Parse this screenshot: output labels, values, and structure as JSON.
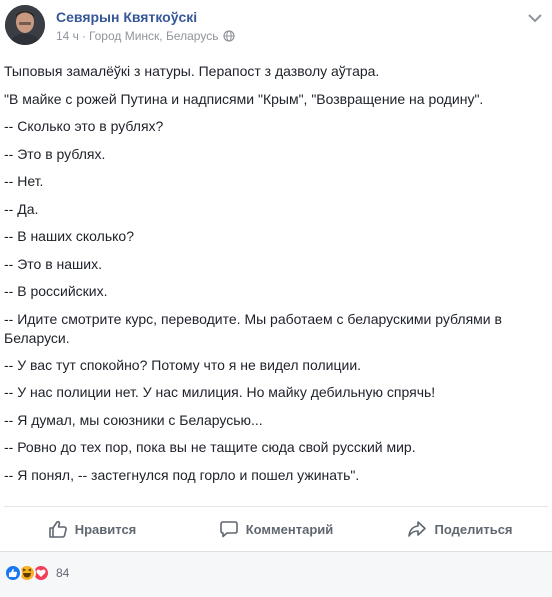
{
  "post": {
    "author": "Севярын Квяткоўскі",
    "time": "14 ч",
    "separator": "·",
    "location": "Город Минск, Беларусь",
    "privacy_icon": "globe-icon",
    "menu_icon": "chevron-down-icon",
    "paragraphs": [
      "Тыповыя замалёўкі з натуры. Перапост з дазволу аўтара.",
      "\"В майке с рожей Путина и надписями \"Крым\", \"Возвращение на родину\".",
      "-- Сколько это в рублях?",
      "-- Это в рублях.",
      "-- Нет.",
      "-- Да.",
      "-- В наших сколько?",
      "-- Это в наших.",
      "-- В российских.",
      "-- Идите смотрите курс, переводите. Мы работаем с беларускими рублями в Беларуси.",
      "-- У вас тут спокойно? Потому что я не видел полиции.",
      "-- У нас полиции нет. У нас милиция. Но майку дебильную спрячь!",
      "-- Я думал, мы союзники с Беларусью...",
      "-- Ровно до тех пор, пока вы не тащите сюда свой русский мир.",
      "-- Я понял, -- застегнулся под горло и пошел ужинать\"."
    ]
  },
  "actions": {
    "like_label": "Нравится",
    "comment_label": "Комментарий",
    "share_label": "Поделиться"
  },
  "reactions": {
    "types": [
      "like-icon",
      "haha-icon",
      "love-icon"
    ],
    "count": "84"
  },
  "colors": {
    "author_link": "#365899",
    "meta_text": "#90949c",
    "action_text": "#606770",
    "like_blue": "#1877f2",
    "haha_yellow": "#f7b125",
    "love_red": "#f33e58",
    "footer_bg": "#f6f7f9"
  }
}
